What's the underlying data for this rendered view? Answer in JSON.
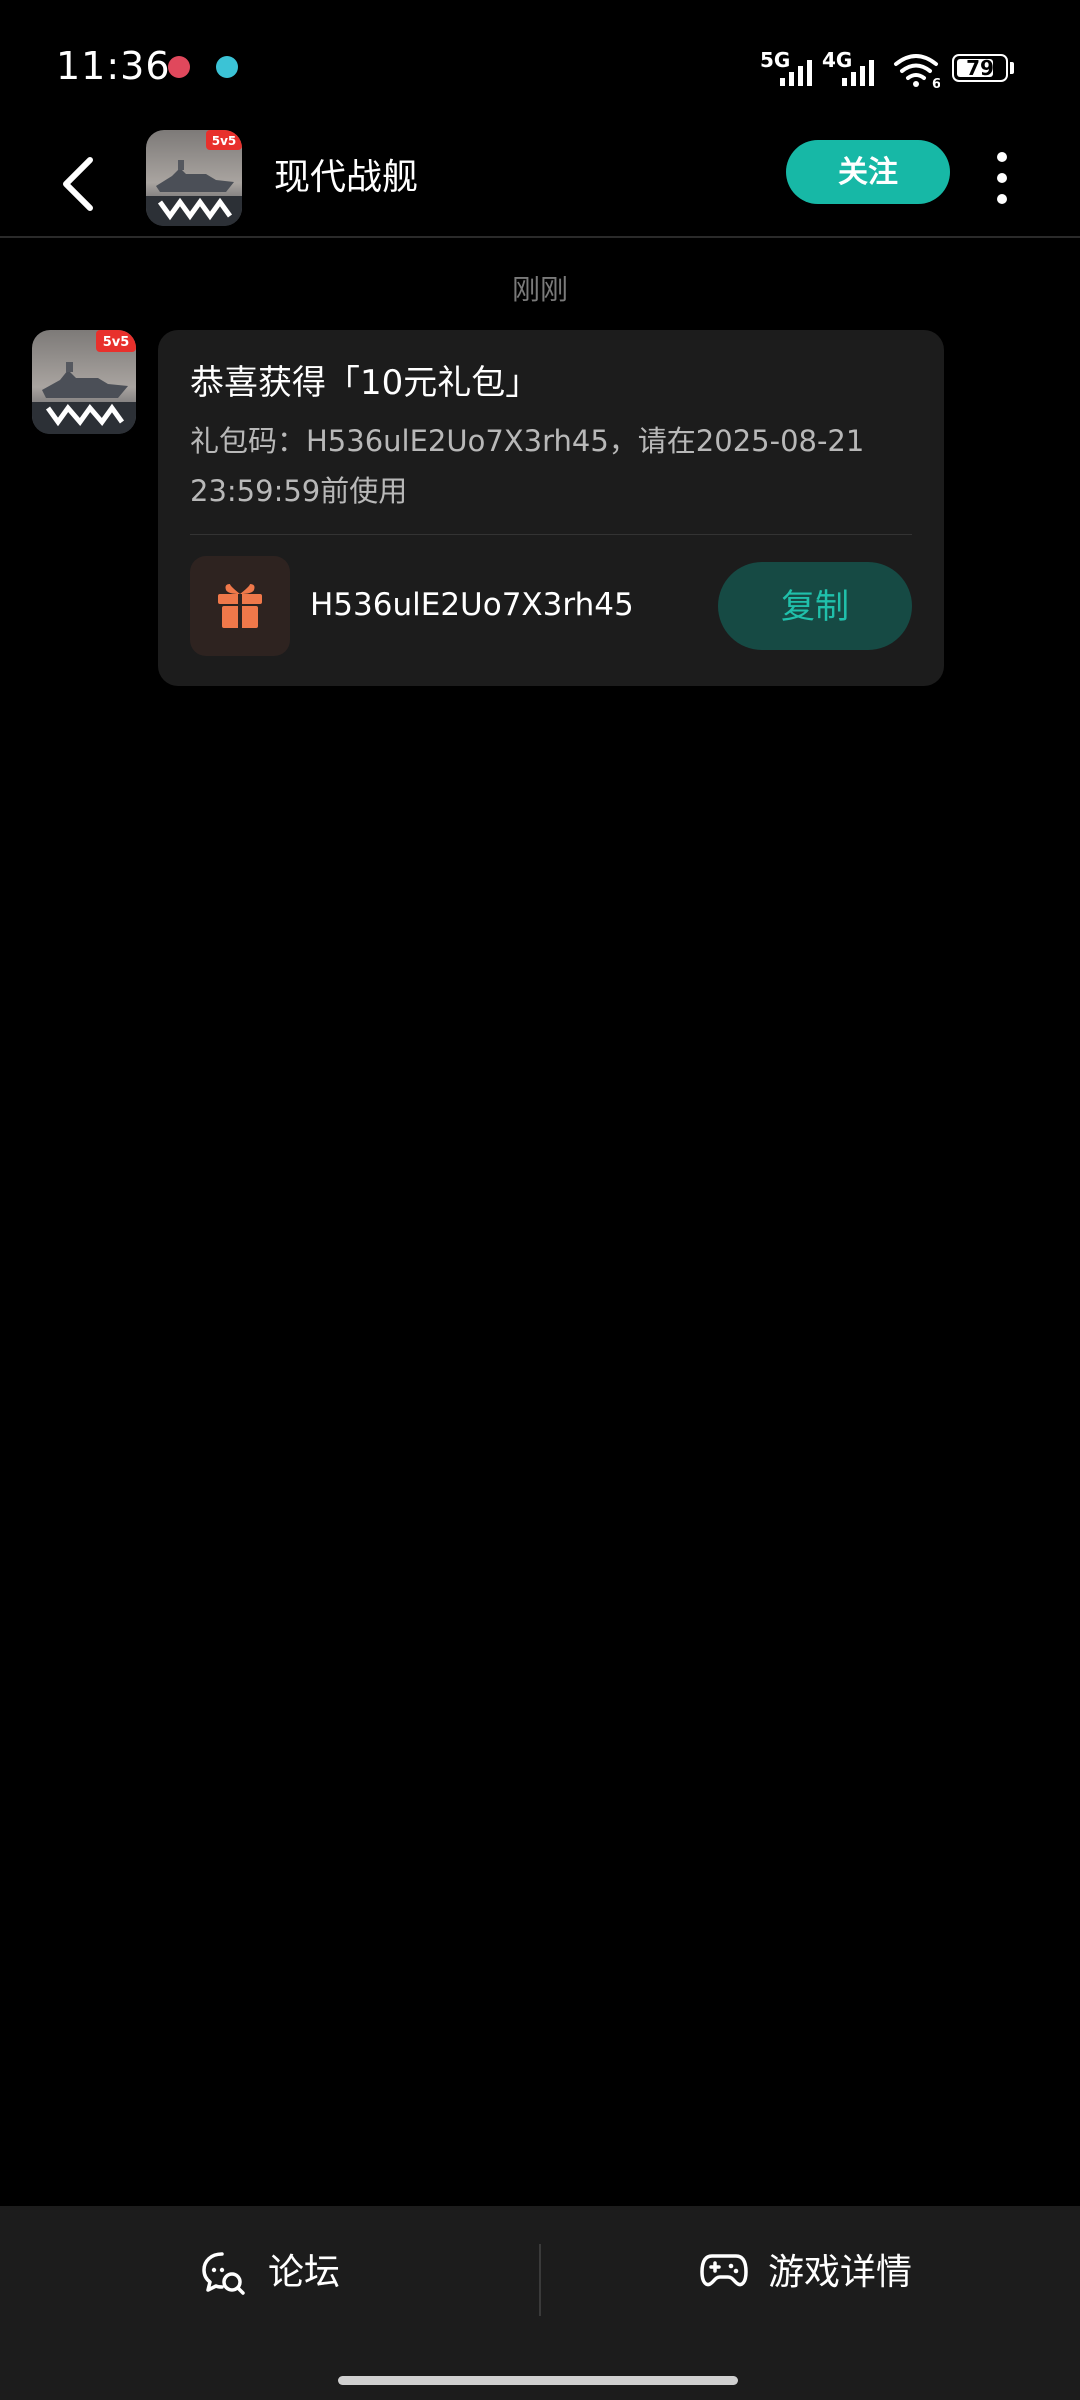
{
  "status_bar": {
    "time": "11:36",
    "signal_1": "5G",
    "signal_2": "4G",
    "wifi_sub": "6",
    "battery_level": "79",
    "battery_fraction": 0.79
  },
  "header": {
    "title": "现代战舰",
    "app_badge": "5v5",
    "follow_label": "关注"
  },
  "message": {
    "timestamp": "刚刚",
    "avatar_badge": "5v5",
    "title": "恭喜获得「10元礼包」",
    "body": "礼包码：H536ulE2Uo7X3rh45，请在2025-08-21 23:59:59前使用",
    "code": "H536ulE2Uo7X3rh45",
    "copy_label": "复制"
  },
  "bottom_bar": {
    "forum_label": "论坛",
    "details_label": "游戏详情"
  },
  "colors": {
    "accent": "#17b8a6",
    "copy_bg": "#164a44",
    "copy_text": "#20c0ab",
    "gift_icon": "#f0784a",
    "badge_red": "#e8302c"
  }
}
